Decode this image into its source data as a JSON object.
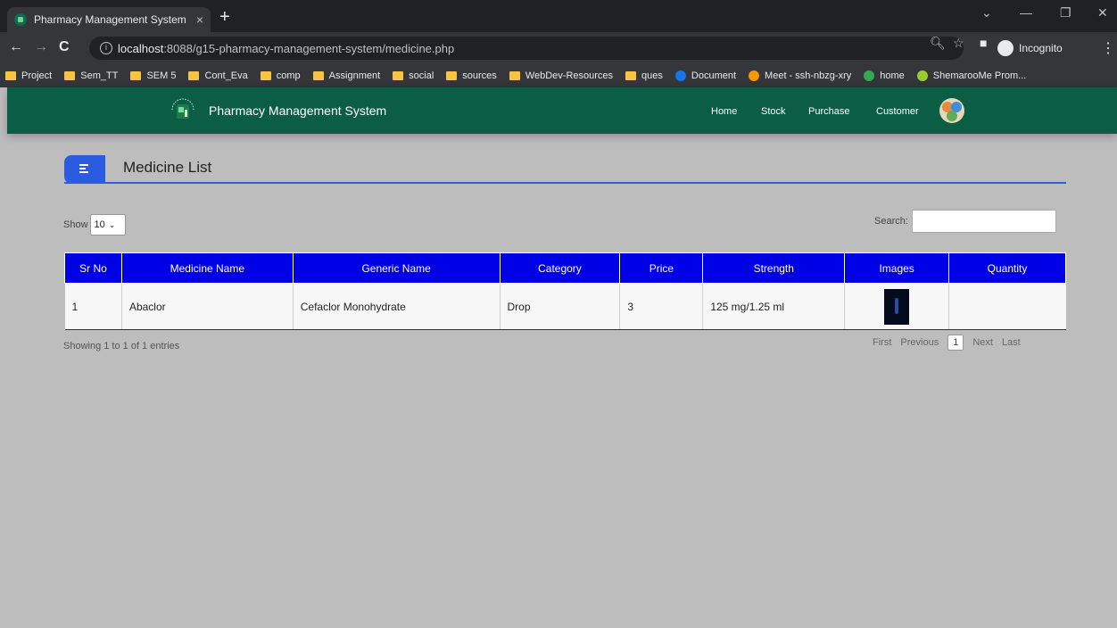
{
  "browser": {
    "tab_title": "Pharmacy Management System",
    "tab_close": "×",
    "new_tab": "+",
    "url_host": "localhost",
    "url_rest": ":8088/g15-pharmacy-management-system/medicine.php",
    "incognito_label": "Incognito",
    "bookmarks": [
      {
        "label": "Project",
        "type": "folder"
      },
      {
        "label": "Sem_TT",
        "type": "folder"
      },
      {
        "label": "SEM 5",
        "type": "folder"
      },
      {
        "label": "Cont_Eva",
        "type": "folder"
      },
      {
        "label": "comp",
        "type": "folder"
      },
      {
        "label": "Assignment",
        "type": "folder"
      },
      {
        "label": "social",
        "type": "folder"
      },
      {
        "label": "sources",
        "type": "folder"
      },
      {
        "label": "WebDev-Resources",
        "type": "folder"
      },
      {
        "label": "ques",
        "type": "folder"
      },
      {
        "label": "Document",
        "type": "link"
      },
      {
        "label": "Meet - ssh-nbzg-xry",
        "type": "link"
      },
      {
        "label": "home",
        "type": "link"
      },
      {
        "label": "ShemarooMe Prom...",
        "type": "link"
      }
    ]
  },
  "navbar": {
    "brand": "Pharmacy Management System",
    "links": [
      "Home",
      "Stock",
      "Purchase",
      "Customer"
    ]
  },
  "page": {
    "heading": "Medicine List",
    "show_label": "Show",
    "show_value": "10",
    "search_label": "Search:",
    "search_value": ""
  },
  "table": {
    "columns": [
      "Sr No",
      "Medicine Name",
      "Generic Name",
      "Category",
      "Price",
      "Strength",
      "Images",
      "Quantity"
    ],
    "rows": [
      {
        "sr": "1",
        "name": "Abaclor",
        "generic": "Cefaclor Monohydrate",
        "category": "Drop",
        "price": "3",
        "strength": "125 mg/1.25 ml",
        "quantity": ""
      }
    ]
  },
  "footer": {
    "info": "Showing 1 to 1 of 1 entries",
    "first": "First",
    "previous": "Previous",
    "current_page": "1",
    "next": "Next",
    "last": "Last"
  },
  "colors": {
    "navbar": "#0b5e44",
    "header_blue": "#0000e6",
    "accent_blue": "#2a5be0",
    "page_bg": "#bdbdbd"
  }
}
